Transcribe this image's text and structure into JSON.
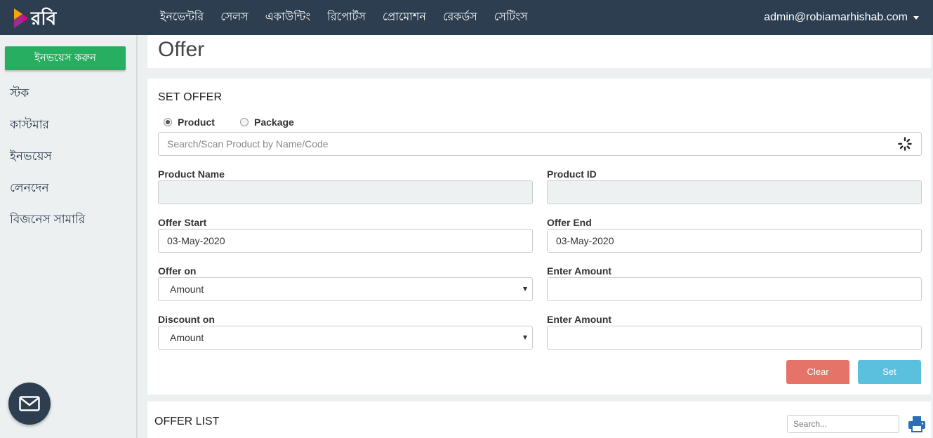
{
  "brand": {
    "name": "রবি"
  },
  "nav": {
    "items": [
      {
        "label": "ইনভেন্টরি"
      },
      {
        "label": "সেলস"
      },
      {
        "label": "একাউন্টিং"
      },
      {
        "label": "রিপোর্টস"
      },
      {
        "label": "প্রোমোশন"
      },
      {
        "label": "রেকর্ডস"
      },
      {
        "label": "সেটিংস"
      }
    ],
    "user": "admin@robiamarhishab.com"
  },
  "sidebar": {
    "cta_label": "ইনভয়েস করুন",
    "items": [
      {
        "label": "স্টক"
      },
      {
        "label": "কাস্টমার"
      },
      {
        "label": "ইনভয়েস"
      },
      {
        "label": "লেনদেন"
      },
      {
        "label": "বিজনেস সামারি"
      }
    ]
  },
  "page": {
    "title": "Offer"
  },
  "set_offer": {
    "title": "SET OFFER",
    "radio_product": "Product",
    "radio_package": "Package",
    "search_placeholder": "Search/Scan Product by Name/Code",
    "product_name_label": "Product Name",
    "product_name_value": "",
    "product_id_label": "Product ID",
    "product_id_value": "",
    "offer_start_label": "Offer Start",
    "offer_start_value": "03-May-2020",
    "offer_end_label": "Offer End",
    "offer_end_value": "03-May-2020",
    "offer_on_label": "Offer on",
    "offer_on_value": "Amount",
    "offer_amount_label": "Enter Amount",
    "offer_amount_value": "",
    "discount_on_label": "Discount on",
    "discount_on_value": "Amount",
    "discount_amount_label": "Enter Amount",
    "discount_amount_value": "",
    "clear_label": "Clear",
    "set_label": "Set"
  },
  "offer_list": {
    "title": "OFFER LIST",
    "search_placeholder": "Search..."
  },
  "colors": {
    "navbar": "#2c3e50",
    "cta": "#27ae60",
    "clear_button": "#e57368",
    "set_button": "#5bc0de",
    "print_icon": "#2a6fb5"
  },
  "icons": [
    "robi-logo-icon",
    "chevron-down-icon",
    "loading-spinner-icon",
    "mail-icon",
    "print-icon"
  ]
}
